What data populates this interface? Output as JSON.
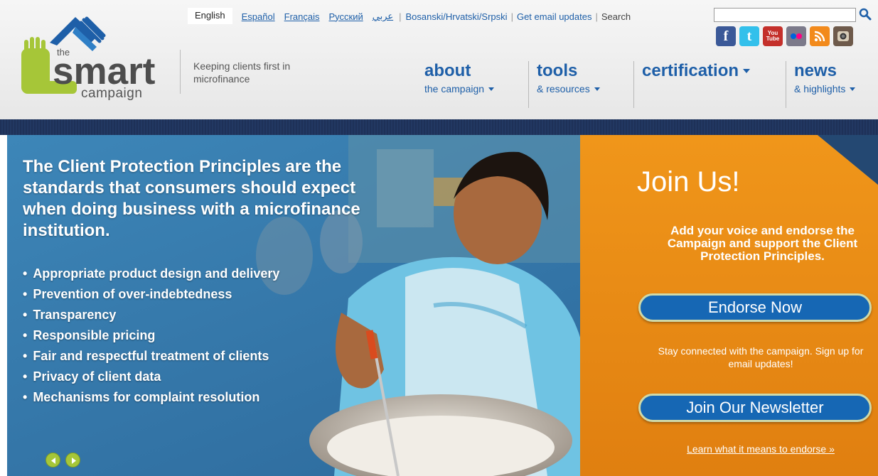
{
  "logo": {
    "the": "the",
    "smart": "smart",
    "campaign": "campaign",
    "tagline": "Keeping clients first in microfinance"
  },
  "languages": {
    "current": "English",
    "links": [
      "Español",
      "Français",
      "Русский",
      "عربي"
    ],
    "bosnian": "Bosanski/Hrvatski/Srpski",
    "email_updates": "Get email updates",
    "search_label": "Search",
    "search_value": ""
  },
  "social": [
    {
      "icon": "facebook-icon",
      "glyph": "f",
      "color": "#3b5998"
    },
    {
      "icon": "twitter-icon",
      "glyph": "t",
      "color": "#33c0eb"
    },
    {
      "icon": "youtube-icon",
      "glyph": "You Tube",
      "color": "#c4302b"
    },
    {
      "icon": "flickr-icon",
      "glyph": "●●",
      "color": "#7c7a8a"
    },
    {
      "icon": "rss-icon",
      "glyph": "≈",
      "color": "#f28a1c"
    },
    {
      "icon": "instagram-icon",
      "glyph": "◉",
      "color": "#6e5a4b"
    }
  ],
  "nav": [
    {
      "title": "about",
      "sub": "the campaign"
    },
    {
      "title": "tools",
      "sub": "& resources"
    },
    {
      "title": "certification",
      "sub": ""
    },
    {
      "title": "news",
      "sub": "& highlights"
    }
  ],
  "hero": {
    "heading": "The Client Protection Principles are the standards that consumers should expect when doing business with a microfinance institution.",
    "principles": [
      "Appropriate product design and delivery",
      "Prevention of over-indebtedness",
      "Transparency",
      "Responsible pricing",
      "Fair and respectful treatment of clients",
      "Privacy of client data",
      "Mechanisms for complaint resolution"
    ]
  },
  "join": {
    "title": "Join Us!",
    "text": "Add your voice and endorse the Campaign and support the Client Protection Principles.",
    "endorse_button": "Endorse Now",
    "stay_text": "Stay connected with the campaign. Sign up for email updates!",
    "newsletter_button": "Join Our Newsletter",
    "learn_link": "Learn what it means to endorse »"
  },
  "colors": {
    "brand_blue": "#1e5fa8",
    "logo_green": "#a6c638",
    "panel_orange": "#e88a13",
    "button_blue": "#1667b4"
  }
}
